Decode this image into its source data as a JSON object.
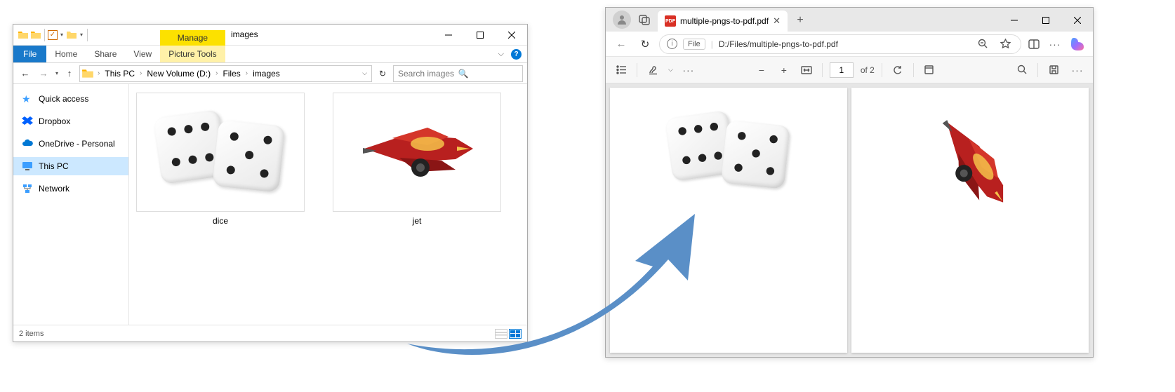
{
  "explorer": {
    "title": "images",
    "manage_label": "Manage",
    "tabs": {
      "file": "File",
      "home": "Home",
      "share": "Share",
      "view": "View",
      "picture": "Picture Tools"
    },
    "breadcrumbs": [
      "This PC",
      "New Volume (D:)",
      "Files",
      "images"
    ],
    "search_placeholder": "Search images",
    "sidebar": {
      "items": [
        {
          "label": "Quick access"
        },
        {
          "label": "Dropbox"
        },
        {
          "label": "OneDrive - Personal"
        },
        {
          "label": "This PC"
        },
        {
          "label": "Network"
        }
      ]
    },
    "files": [
      {
        "name": "dice"
      },
      {
        "name": "jet"
      }
    ],
    "status": "2 items"
  },
  "edge": {
    "tab_title": "multiple-pngs-to-pdf.pdf",
    "url_tag": "File",
    "url": "D:/Files/multiple-pngs-to-pdf.pdf",
    "page_current": "1",
    "page_total": "of 2"
  }
}
